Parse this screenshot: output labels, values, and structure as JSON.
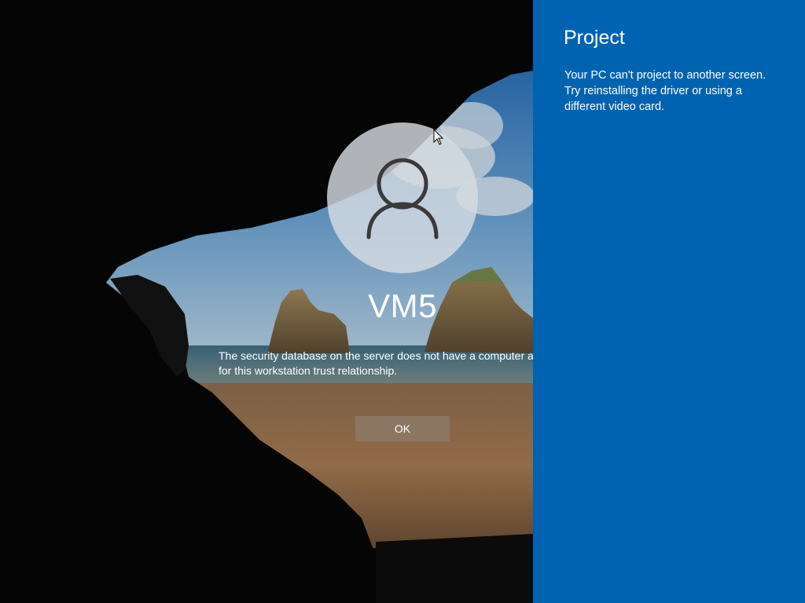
{
  "login": {
    "username": "VM5",
    "message_line1": "The security database on the server does not have a computer account",
    "message_line2": "for this workstation trust relationship.",
    "ok_label": "OK"
  },
  "project_panel": {
    "title": "Project",
    "message": "Your PC can't project to another screen. Try reinstalling the driver or using a different video card."
  },
  "colors": {
    "panel_background": "#0063b1",
    "text": "#ffffff"
  },
  "icons": {
    "avatar": "user-silhouette-icon",
    "cursor": "mouse-pointer-icon"
  }
}
